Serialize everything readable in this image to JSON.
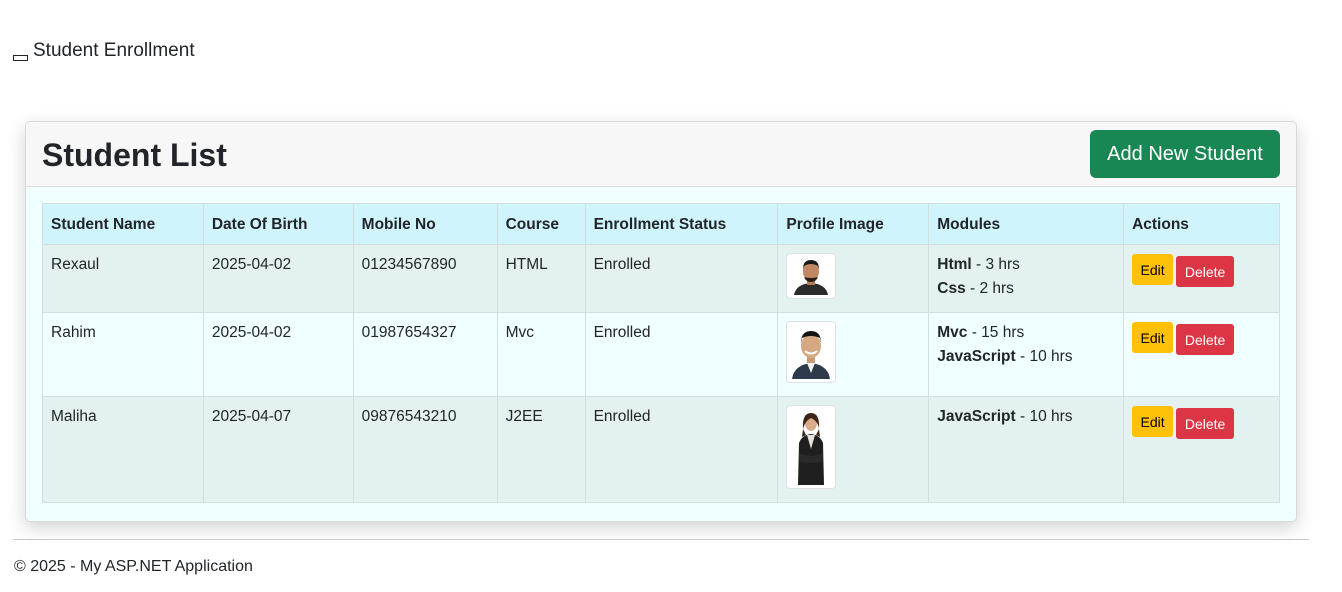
{
  "brand": {
    "title": "Student Enrollment"
  },
  "card": {
    "title": "Student List",
    "add_button": "Add New Student"
  },
  "table": {
    "headers": [
      "Student Name",
      "Date Of Birth",
      "Mobile No",
      "Course",
      "Enrollment Status",
      "Profile Image",
      "Modules",
      "Actions"
    ],
    "rows": [
      {
        "name": "Rexaul",
        "dob": "2025-04-02",
        "mobile": "01234567890",
        "course": "HTML",
        "status": "Enrolled",
        "image": "profile-photo-man-beard",
        "modules": [
          {
            "name": "Html",
            "duration": " - 3 hrs"
          },
          {
            "name": "Css",
            "duration": " - 2 hrs"
          }
        ],
        "edit": "Edit",
        "delete": "Delete"
      },
      {
        "name": "Rahim",
        "dob": "2025-04-02",
        "mobile": "01987654327",
        "course": "Mvc",
        "status": "Enrolled",
        "image": "profile-photo-man-smiling",
        "modules": [
          {
            "name": "Mvc",
            "duration": " - 15 hrs"
          },
          {
            "name": "JavaScript",
            "duration": " - 10 hrs"
          }
        ],
        "edit": "Edit",
        "delete": "Delete"
      },
      {
        "name": "Maliha",
        "dob": "2025-04-07",
        "mobile": "09876543210",
        "course": "J2EE",
        "status": "Enrolled",
        "image": "profile-photo-woman-business",
        "modules": [
          {
            "name": "JavaScript",
            "duration": " - 10 hrs"
          }
        ],
        "edit": "Edit",
        "delete": "Delete"
      }
    ]
  },
  "footer": {
    "text": "© 2025 - My ASP.NET Application"
  },
  "colors": {
    "add_button": "#198754",
    "edit_button": "#ffc107",
    "delete_button": "#dc3545",
    "table_header": "#cff4fc",
    "card_body": "#f0ffff"
  }
}
